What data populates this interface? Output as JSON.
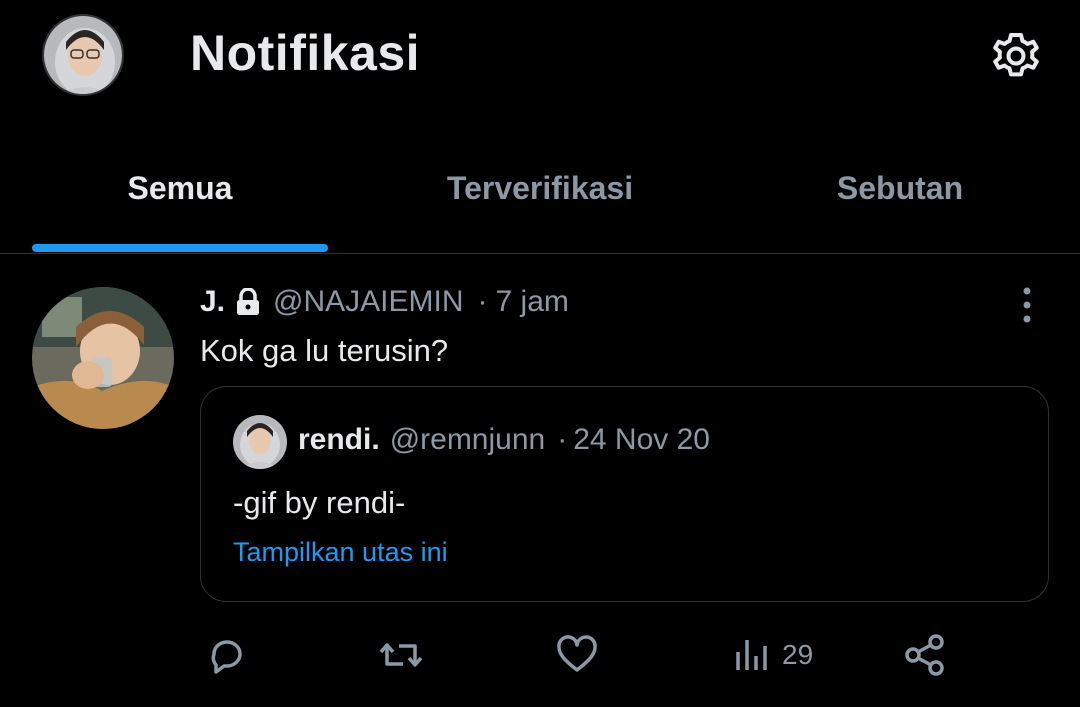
{
  "header": {
    "title": "Notifikasi",
    "avatar_icon": "user-avatar",
    "settings_icon": "gear-icon"
  },
  "tabs": [
    {
      "label": "Semua",
      "active": true
    },
    {
      "label": "Terverifikasi",
      "active": false
    },
    {
      "label": "Sebutan",
      "active": false
    }
  ],
  "tweet": {
    "author_name": "J.",
    "protected": true,
    "handle": "@NAJAIEMIN",
    "separator": "·",
    "time": "7 jam",
    "text": "Kok ga lu terusin?",
    "quote": {
      "author_name": "rendi.",
      "handle": "@remnjunn",
      "separator": "·",
      "date": "24 Nov 20",
      "text": "-gif by rendi-",
      "thread_link": "Tampilkan utas ini"
    },
    "actions": {
      "reply_icon": "reply-icon",
      "retweet_icon": "retweet-icon",
      "like_icon": "heart-icon",
      "views_icon": "views-icon",
      "views_count": "29",
      "share_icon": "share-icon"
    }
  },
  "colors": {
    "background": "#000000",
    "text_primary": "#e7e9ea",
    "text_secondary": "#8b98a5",
    "accent": "#1d9bf0",
    "border": "#2f3336"
  }
}
